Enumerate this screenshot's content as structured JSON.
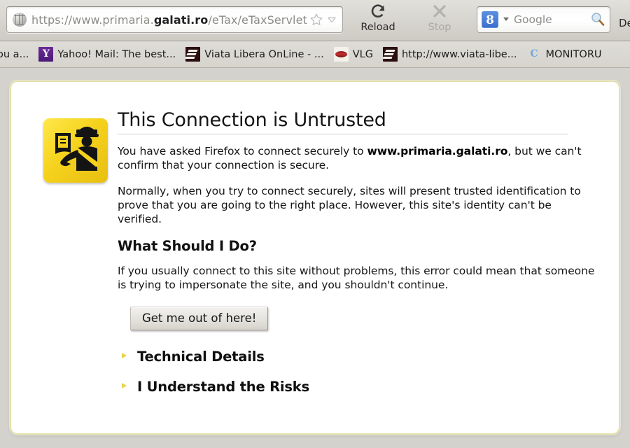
{
  "browser": {
    "urlbar": {
      "favicon": "globe-icon",
      "url_prefix": "https://www.primaria.",
      "url_domain": "galati.ro",
      "url_path": "/eTax/eTaxServlet",
      "full_url": "https://www.primaria.galati.ro/eTax/eTaxServlet",
      "star_icon": "star-icon",
      "dropmarker_icon": "chevron-down-icon"
    },
    "toolbar": {
      "reload_label": "Reload",
      "reload_icon": "reload-icon",
      "stop_label": "Stop",
      "stop_icon": "close-icon",
      "overflow_label": "De"
    },
    "search": {
      "engine_icon": "google-g-icon",
      "engine_letter": "8",
      "engine_drop_icon": "chevron-down-icon",
      "placeholder": "Google",
      "submit_icon": "magnifier-icon"
    },
    "bookmarks": [
      {
        "label": "ou a...",
        "icon": "none",
        "clipped": true
      },
      {
        "label": "Yahoo! Mail: The best...",
        "icon": "yahoo-icon"
      },
      {
        "label": "Viata Libera OnLine - ...",
        "icon": "viata-libera-icon"
      },
      {
        "label": "VLG",
        "icon": "vlg-icon"
      },
      {
        "label": "http://www.viata-libe...",
        "icon": "viata-libera-icon"
      },
      {
        "label": "MONITORU",
        "icon": "monitorul-icon"
      }
    ]
  },
  "page": {
    "warning_icon": "certificate-warning-icon",
    "title": "This Connection is Untrusted",
    "paragraph1_before": "You have asked Firefox to connect securely to ",
    "paragraph1_strong": "www.primaria.galati.ro",
    "paragraph1_after": ", but we can't confirm that your connection is secure.",
    "paragraph2": "Normally, when you try to connect securely, sites will present trusted identification to prove that you are going to the right place. However, this site's identity can't be verified.",
    "subtitle": "What Should I Do?",
    "paragraph3": "If you usually connect to this site without problems, this error could mean that someone is trying to impersonate the site, and you shouldn't continue.",
    "exit_button_label": "Get me out of here!",
    "expanders": [
      {
        "label": "Technical Details",
        "icon": "triangle-right-icon"
      },
      {
        "label": "I Understand the Risks",
        "icon": "triangle-right-icon"
      }
    ]
  },
  "colors": {
    "page_background": "#d4d2cc",
    "card_border": "#e4e0a8",
    "card_background": "#ffffff",
    "warning_yellow": "#f5d21d",
    "expander_triangle": "#e8d24a",
    "toolbar_background": "#d8d6d0"
  }
}
